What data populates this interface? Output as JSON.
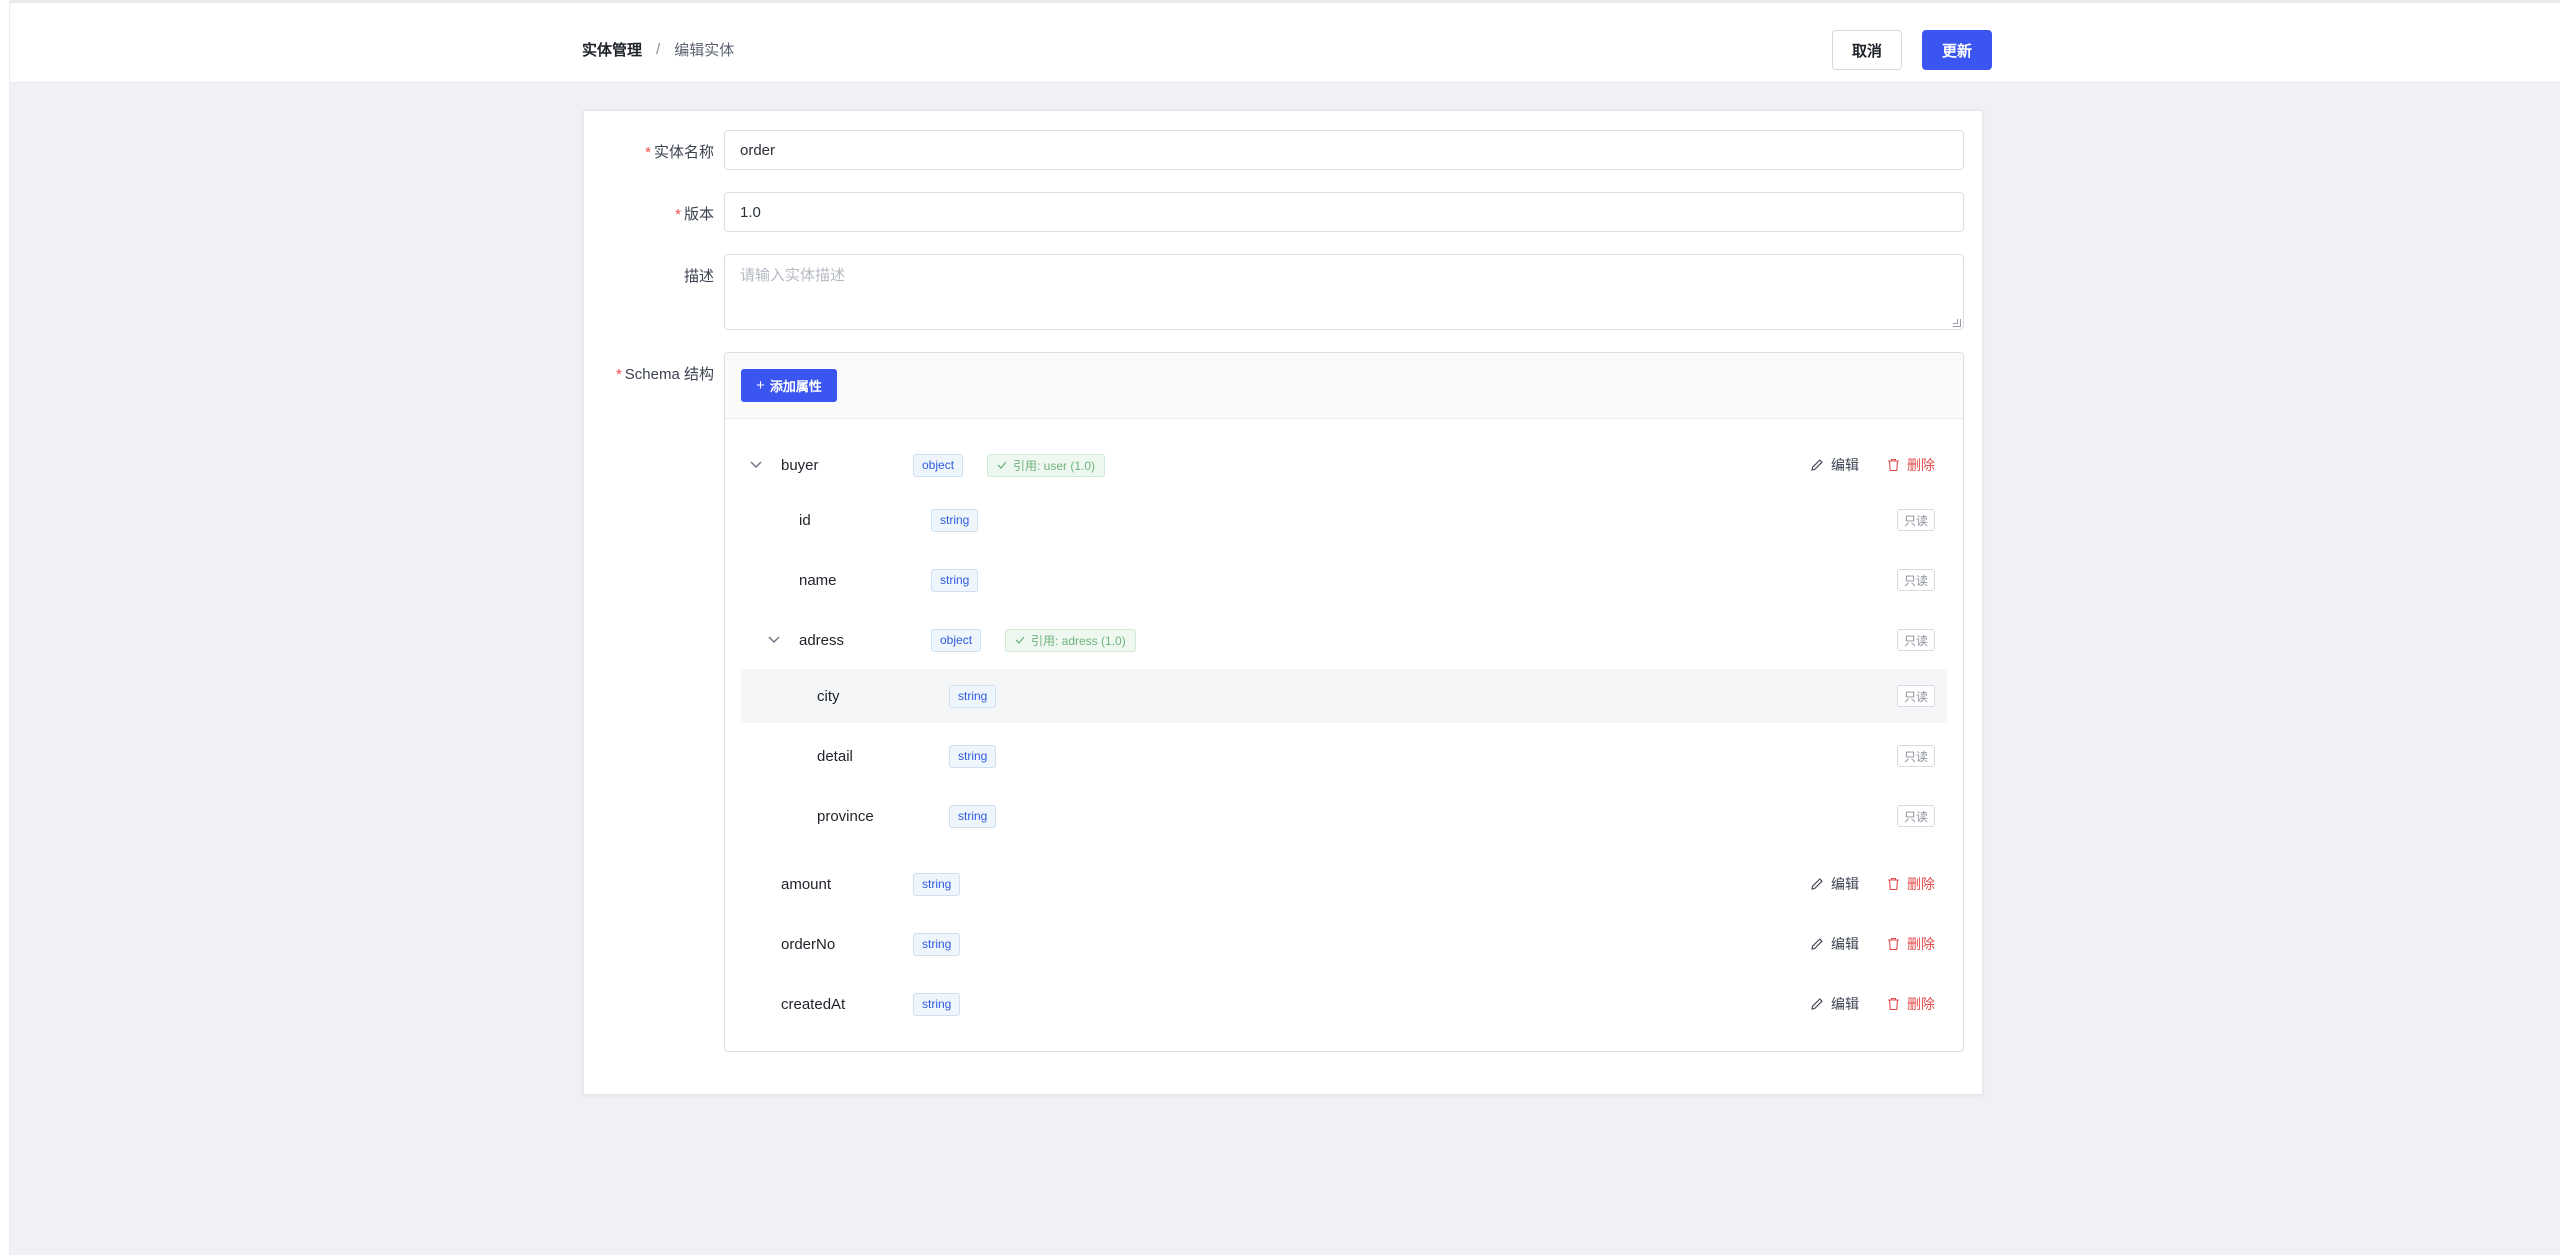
{
  "breadcrumb": {
    "parent": "实体管理",
    "separator": "/",
    "current": "编辑实体"
  },
  "actions": {
    "cancel": "取消",
    "update": "更新"
  },
  "form": {
    "required_mark": "*",
    "name_label": "实体名称",
    "name_value": "order",
    "version_label": "版本",
    "version_value": "1.0",
    "desc_label": "描述",
    "desc_placeholder": "请输入实体描述",
    "schema_label": "Schema 结构"
  },
  "schema": {
    "add_button": "添加属性",
    "add_icon": "+",
    "edit_label": "编辑",
    "delete_label": "删除",
    "readonly_label": "只读",
    "rows": [
      {
        "name": "buyer",
        "type": "object",
        "ref": "引用: user (1.0)",
        "expanded": true,
        "depth": 0,
        "editable": true
      },
      {
        "name": "id",
        "type": "string",
        "depth": 1,
        "editable": false
      },
      {
        "name": "name",
        "type": "string",
        "depth": 1,
        "editable": false
      },
      {
        "name": "adress",
        "type": "object",
        "ref": "引用: adress (1.0)",
        "expanded": true,
        "depth": 1,
        "editable": false
      },
      {
        "name": "city",
        "type": "string",
        "depth": 2,
        "editable": false,
        "highlighted": true
      },
      {
        "name": "detail",
        "type": "string",
        "depth": 2,
        "editable": false
      },
      {
        "name": "province",
        "type": "string",
        "depth": 2,
        "editable": false
      },
      {
        "name": "amount",
        "type": "string",
        "depth": 0,
        "editable": true
      },
      {
        "name": "orderNo",
        "type": "string",
        "depth": 0,
        "editable": true
      },
      {
        "name": "createdAt",
        "type": "string",
        "depth": 0,
        "editable": true
      }
    ]
  },
  "colors": {
    "primary": "#3a55f0",
    "danger": "#e24b4b",
    "ref_green": "#6fb27c",
    "type_blue": "#2f5ae0"
  }
}
